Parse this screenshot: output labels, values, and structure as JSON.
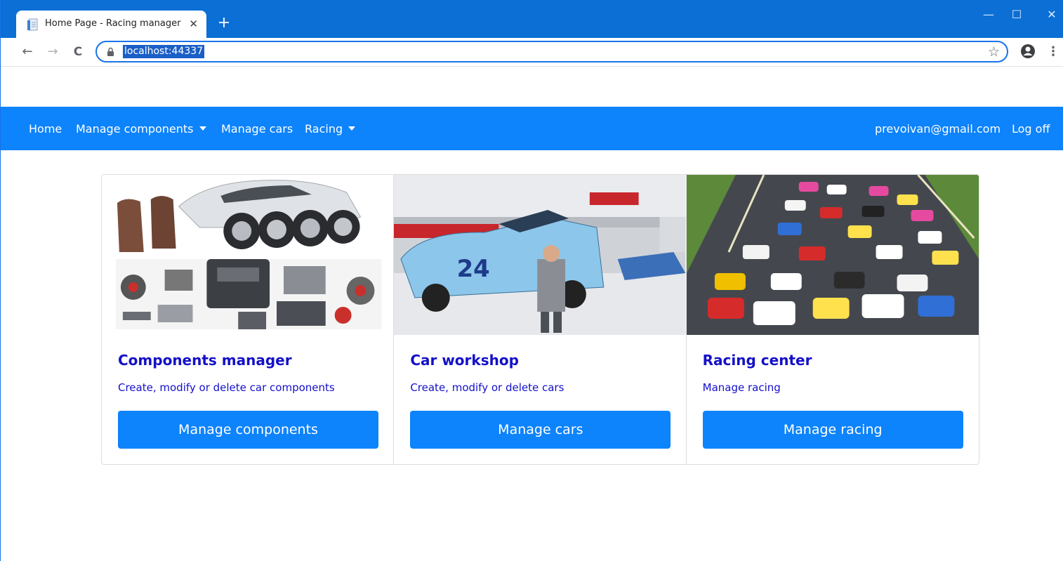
{
  "browser": {
    "tab_title": "Home Page - Racing manager",
    "tab_close": "✕",
    "new_tab": "+",
    "controls": {
      "minimize": "—",
      "maximize": "☐",
      "close": "✕"
    },
    "back": "←",
    "forward": "→",
    "reload": "C",
    "url": "localhost:44337",
    "bookmark": "☆",
    "menu": "⋮"
  },
  "navbar": {
    "links": [
      {
        "label": "Home"
      },
      {
        "label": "Manage components"
      },
      {
        "label": "Manage cars"
      },
      {
        "label": "Racing"
      }
    ],
    "user_email": "prevoivan@gmail.com",
    "logoff_label": "Log off"
  },
  "cards": [
    {
      "title": "Components manager",
      "text": "Create, modify or delete car components",
      "button": "Manage components"
    },
    {
      "title": "Car workshop",
      "text": "Create, modify or delete cars",
      "button": "Manage cars"
    },
    {
      "title": "Racing center",
      "text": "Manage racing",
      "button": "Manage racing"
    }
  ],
  "colors": {
    "tabstrip": "#0b6fd6",
    "navbar": "#0d83fc",
    "button": "#0d83fc",
    "card_text": "#1410c8"
  }
}
